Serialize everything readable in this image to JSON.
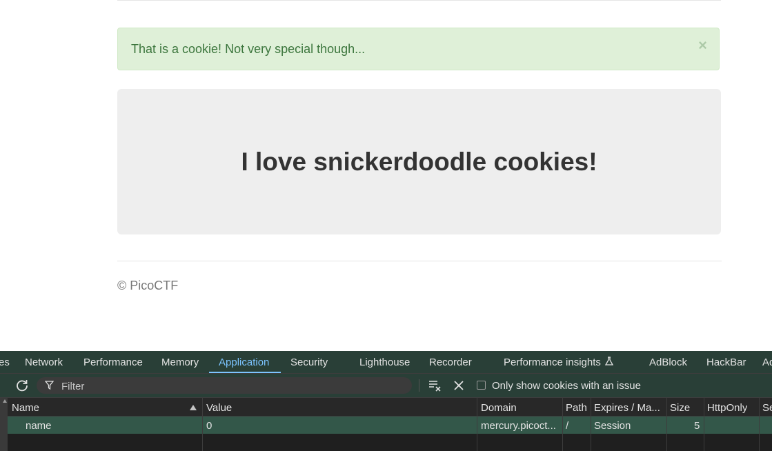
{
  "page": {
    "alert_text": "That is a cookie! Not very special though...",
    "alert_close": "×",
    "heading": "I love snickerdoodle cookies!",
    "footer": "© PicoCTF"
  },
  "devtools": {
    "tabs": [
      {
        "label": "es"
      },
      {
        "label": "Network"
      },
      {
        "label": "Performance"
      },
      {
        "label": "Memory"
      },
      {
        "label": "Application",
        "active": true
      },
      {
        "label": "Security"
      },
      {
        "label": "Lighthouse"
      },
      {
        "label": "Recorder"
      },
      {
        "label": "Performance insights"
      },
      {
        "label": "AdBlock"
      },
      {
        "label": "HackBar"
      },
      {
        "label": "Ad"
      }
    ],
    "toolbar": {
      "filter_placeholder": "Filter",
      "issue_checkbox_label": "Only show cookies with an issue"
    },
    "table": {
      "headers": [
        "Name",
        "Value",
        "Domain",
        "Path",
        "Expires / Ma...",
        "Size",
        "HttpOnly",
        "Se"
      ],
      "rows": [
        {
          "name": "name",
          "value": "0",
          "domain": "mercury.picoct...",
          "path": "/",
          "expires": "Session",
          "size": "5",
          "httponly": "",
          "secure": ""
        }
      ]
    }
  },
  "colors": {
    "alert_bg": "#dff0d8",
    "alert_text": "#3c763d",
    "jumbotron_bg": "#eeeeee",
    "devtools_bg": "#282828",
    "active_tab": "#7cc4ff",
    "selected_row": "#335749"
  },
  "icons": [
    "refresh-icon",
    "filter-icon",
    "clear-all-icon",
    "delete-icon",
    "flask-icon",
    "sort-ascending-icon",
    "close-icon"
  ]
}
